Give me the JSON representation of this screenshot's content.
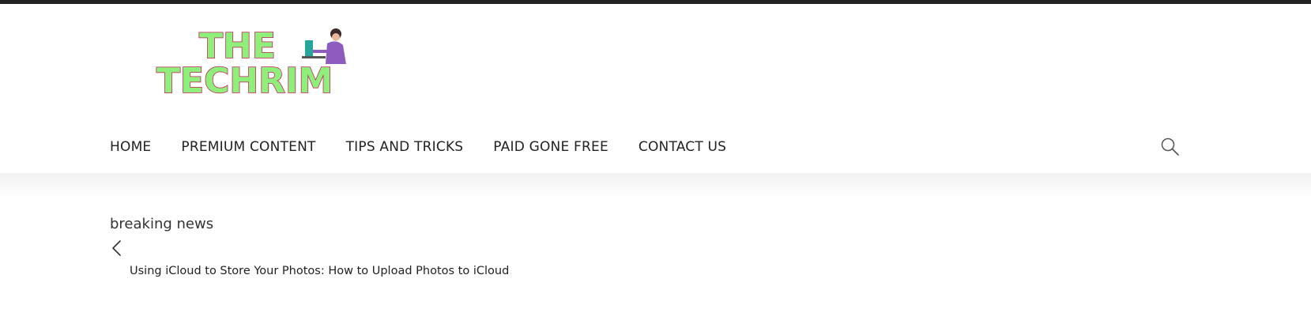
{
  "logo": {
    "line1": "THE",
    "line2": "TECHRIM",
    "colors": {
      "fill": "#8ef07a",
      "outline": "#c2185b",
      "person_shirt": "#8e5bbf",
      "laptop": "#26a69a"
    }
  },
  "nav": {
    "items": [
      {
        "label": "HOME"
      },
      {
        "label": "PREMIUM CONTENT"
      },
      {
        "label": "TIPS AND TRICKS"
      },
      {
        "label": "PAID GONE FREE"
      },
      {
        "label": "CONTACT US"
      }
    ],
    "search_icon": "search-icon"
  },
  "breaking": {
    "label": "breaking news",
    "prev_icon": "chevron-left-icon",
    "headline": "Using iCloud to Store Your Photos: How to Upload Photos to iCloud"
  }
}
